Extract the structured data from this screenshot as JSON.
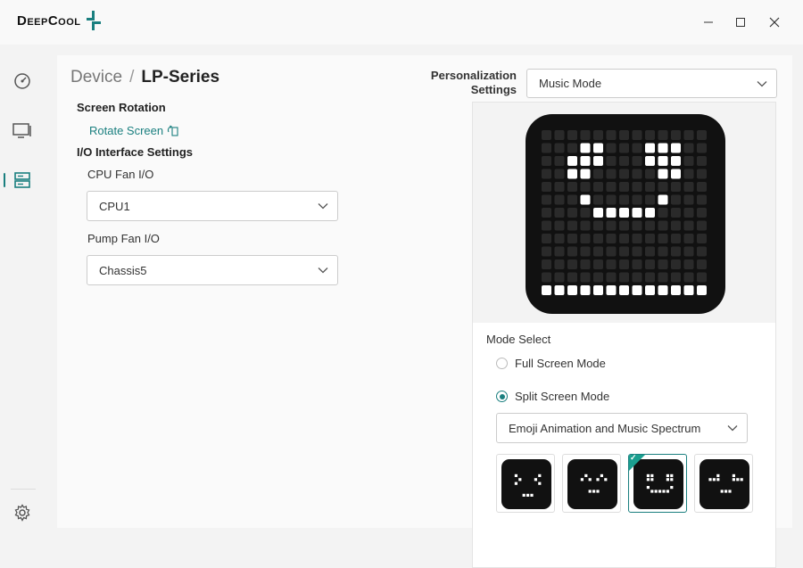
{
  "app": {
    "brand": "DeepCool",
    "colors": {
      "accent": "#1a7f7f",
      "screen": "#111111",
      "led_on": "#ffffff",
      "led_off": "#2a2a2a"
    }
  },
  "window_controls": {
    "minimize": "minimize-icon",
    "maximize": "maximize-icon",
    "close": "close-icon"
  },
  "sidebar": {
    "items": [
      {
        "icon": "dashboard-gauge-icon"
      },
      {
        "icon": "monitor-icon"
      },
      {
        "icon": "device-stack-icon",
        "active": true
      }
    ],
    "footer_icon": "settings-gear-icon"
  },
  "breadcrumb": {
    "parent": "Device",
    "separator": "/",
    "current": "LP-Series"
  },
  "screen_rotation": {
    "title": "Screen Rotation",
    "link_label": "Rotate Screen"
  },
  "io_settings": {
    "title": "I/O Interface Settings",
    "cpu_fan_label": "CPU Fan I/O",
    "cpu_fan_value": "CPU1",
    "pump_fan_label": "Pump Fan I/O",
    "pump_fan_value": "Chassis5"
  },
  "personalization": {
    "label_line1": "Personalization",
    "label_line2": "Settings",
    "value": "Music Mode"
  },
  "mode_select": {
    "title": "Mode Select",
    "options": [
      {
        "label": "Full Screen Mode",
        "selected": false
      },
      {
        "label": "Split Screen Mode",
        "selected": true
      }
    ],
    "split_value": "Emoji Animation and Music Spectrum",
    "thumbnails": [
      {
        "icon": "emoji-squint-icon",
        "selected": false
      },
      {
        "icon": "emoji-happy-icon",
        "selected": false
      },
      {
        "icon": "emoji-smile-icon",
        "selected": true
      },
      {
        "icon": "emoji-neutral-icon",
        "selected": false
      }
    ]
  }
}
